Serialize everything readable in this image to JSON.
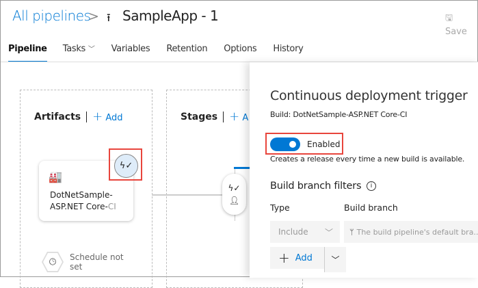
{
  "header": {
    "breadcrumb": "All pipelines",
    "separator": ">",
    "pipeline_icon": "release-pipeline-icon",
    "title": "SampleApp - 1",
    "save_label": "Save"
  },
  "tabs": [
    {
      "label": "Pipeline",
      "active": true
    },
    {
      "label": "Tasks"
    },
    {
      "label": "Variables"
    },
    {
      "label": "Retention"
    },
    {
      "label": "Options"
    },
    {
      "label": "History"
    }
  ],
  "tasks_chevron": "⌵",
  "canvas": {
    "artifacts": {
      "heading": "Artifacts",
      "add_label": "Add",
      "card": {
        "name_line1": "DotNetSample-",
        "name_line2": "ASP.NET Core-",
        "name_suffix": "CI"
      },
      "schedule": "Schedule not set"
    },
    "stages": {
      "heading": "Stages",
      "add_label": "A"
    }
  },
  "panel": {
    "title": "Continuous deployment trigger",
    "build": "Build: DotNetSample-ASP.NET Core-CI",
    "toggle": {
      "enabled": true,
      "label": "Enabled"
    },
    "description": "Creates a release every time a new build is available.",
    "filters_heading": "Build branch filters",
    "col_type": "Type",
    "col_branch": "Build branch",
    "type_value": "Include",
    "branch_placeholder": "The build pipeline's default bra...",
    "add_label": "Add"
  },
  "colors": {
    "accent": "#0078d4",
    "highlight": "#e8453c"
  }
}
